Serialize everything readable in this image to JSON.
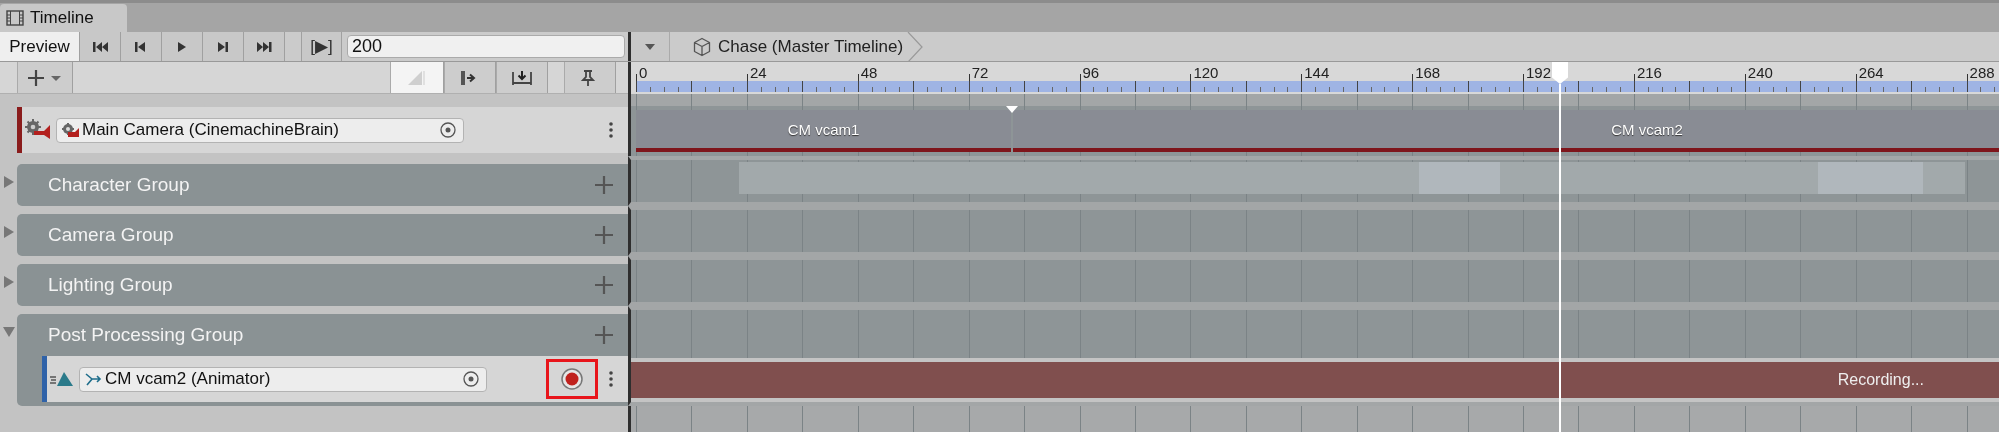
{
  "window_tab": {
    "title": "Timeline",
    "selected": true
  },
  "toolbar": {
    "preview": {
      "label": "Preview",
      "on": true
    },
    "play_range": "[▶]",
    "frame_field": {
      "value": "200"
    }
  },
  "breadcrumb": {
    "title": "Chase (Master Timeline)"
  },
  "ruler": {
    "labels": [
      "0",
      "24",
      "48",
      "72",
      "96",
      "120",
      "144",
      "168",
      "192",
      "216",
      "240",
      "264",
      "288"
    ]
  },
  "tracks": [
    {
      "kind": "camera",
      "name": "Main Camera (CinemachineBrain)",
      "clips": [
        {
          "label": "CM vcam1"
        },
        {
          "label": "CM vcam2"
        }
      ]
    },
    {
      "kind": "group",
      "name": "Character Group",
      "expanded": false,
      "clips": [
        {
          "kind": "plain"
        },
        {
          "kind": "light"
        },
        {
          "kind": "plain"
        },
        {
          "kind": "light"
        },
        {
          "kind": "plain"
        }
      ]
    },
    {
      "kind": "group",
      "name": "Camera Group",
      "expanded": false
    },
    {
      "kind": "group",
      "name": "Lighting Group",
      "expanded": false
    },
    {
      "kind": "group",
      "name": "Post Processing Group",
      "expanded": true,
      "children": [
        {
          "kind": "animator",
          "name": "CM vcam2 (Animator)",
          "recording": true,
          "record_highlighted": true,
          "status": "Recording..."
        }
      ]
    }
  ]
}
